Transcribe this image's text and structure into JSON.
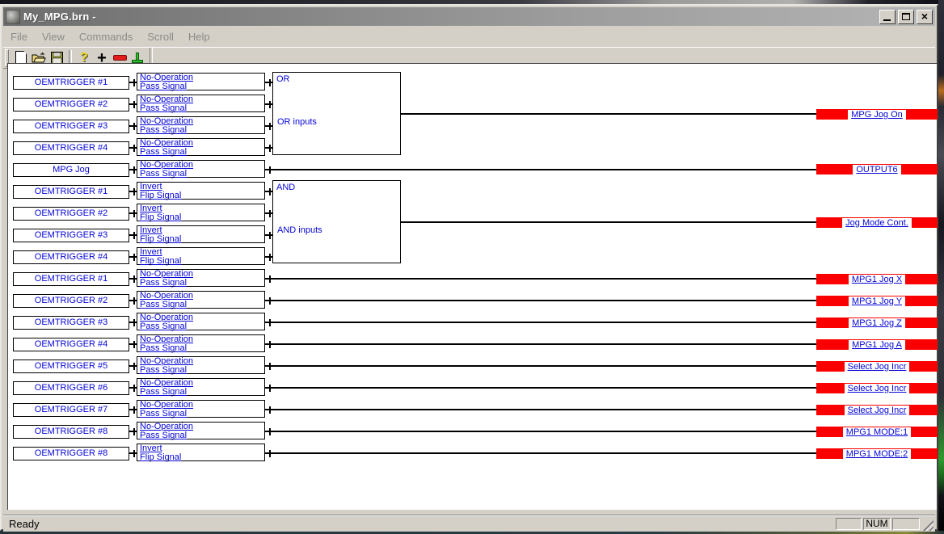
{
  "window": {
    "title": "My_MPG.brn -"
  },
  "menu": {
    "items": [
      "File",
      "View",
      "Commands",
      "Scroll",
      "Help"
    ]
  },
  "toolbar": {
    "button_icons": [
      "new",
      "open",
      "save",
      "help",
      "add",
      "remove",
      "run"
    ]
  },
  "diagram": {
    "rows": [
      {
        "input": "OEMTRIGGER #1",
        "op_line1": "No-Operation",
        "op_line2": "Pass Signal",
        "to": "or"
      },
      {
        "input": "OEMTRIGGER #2",
        "op_line1": "No-Operation",
        "op_line2": "Pass Signal",
        "to": "or"
      },
      {
        "input": "OEMTRIGGER #3",
        "op_line1": "No-Operation",
        "op_line2": "Pass Signal",
        "to": "or"
      },
      {
        "input": "OEMTRIGGER #4",
        "op_line1": "No-Operation",
        "op_line2": "Pass Signal",
        "to": "or"
      },
      {
        "input": "MPG Jog",
        "op_line1": "No-Operation",
        "op_line2": "Pass Signal",
        "to": "output"
      },
      {
        "input": "OEMTRIGGER #1",
        "op_line1": "Invert",
        "op_line2": "Flip Signal",
        "to": "and"
      },
      {
        "input": "OEMTRIGGER #2",
        "op_line1": "Invert",
        "op_line2": "Flip Signal",
        "to": "and"
      },
      {
        "input": "OEMTRIGGER #3",
        "op_line1": "Invert",
        "op_line2": "Flip Signal",
        "to": "and"
      },
      {
        "input": "OEMTRIGGER #4",
        "op_line1": "Invert",
        "op_line2": "Flip Signal",
        "to": "and"
      },
      {
        "input": "OEMTRIGGER #1",
        "op_line1": "No-Operation",
        "op_line2": "Pass Signal",
        "to": "output"
      },
      {
        "input": "OEMTRIGGER #2",
        "op_line1": "No-Operation",
        "op_line2": "Pass Signal",
        "to": "output"
      },
      {
        "input": "OEMTRIGGER #3",
        "op_line1": "No-Operation",
        "op_line2": "Pass Signal",
        "to": "output"
      },
      {
        "input": "OEMTRIGGER #4",
        "op_line1": "No-Operation",
        "op_line2": "Pass Signal",
        "to": "output"
      },
      {
        "input": "OEMTRIGGER #5",
        "op_line1": "No-Operation",
        "op_line2": "Pass Signal",
        "to": "output"
      },
      {
        "input": "OEMTRIGGER #6",
        "op_line1": "No-Operation",
        "op_line2": "Pass Signal",
        "to": "output"
      },
      {
        "input": "OEMTRIGGER #7",
        "op_line1": "No-Operation",
        "op_line2": "Pass Signal",
        "to": "output"
      },
      {
        "input": "OEMTRIGGER #8",
        "op_line1": "No-Operation",
        "op_line2": "Pass Signal",
        "to": "output"
      },
      {
        "input": "OEMTRIGGER #8",
        "op_line1": "Invert",
        "op_line2": "Flip Signal",
        "to": "output"
      }
    ],
    "gates": [
      {
        "id": "or",
        "label": "OR",
        "sublabel": "OR inputs",
        "output": "MPG Jog On"
      },
      {
        "id": "and",
        "label": "AND",
        "sublabel": "AND inputs",
        "output": "Jog Mode Cont."
      }
    ],
    "outputs": [
      "MPG Jog On",
      "OUTPUT6",
      "Jog Mode Cont.",
      "MPG1 Jog X",
      "MPG1 Jog Y",
      "MPG1 Jog Z",
      "MPG1 Jog A",
      "Select Jog Incr",
      "Select Jog Incr",
      "Select Jog Incr",
      "MPG1 MODE:1",
      "MPG1 MODE:2"
    ],
    "colors": {
      "terminal_red": "#fb0000",
      "text_blue": "#0404d8"
    }
  },
  "statusbar": {
    "message": "Ready",
    "indicator": "NUM"
  }
}
